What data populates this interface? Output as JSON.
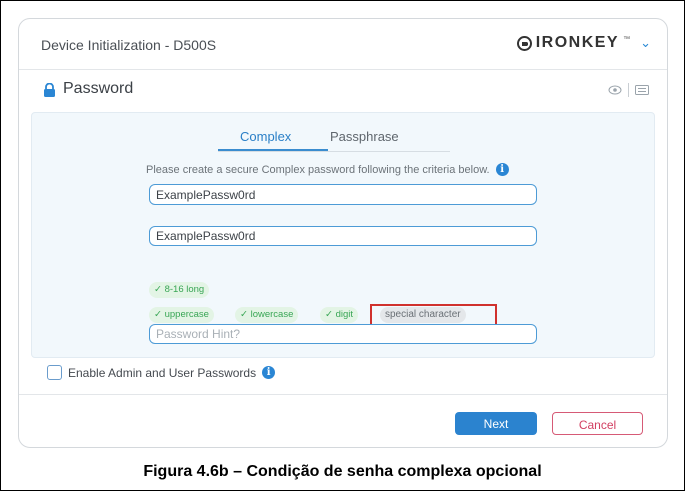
{
  "window": {
    "title": "Device Initialization - D500S",
    "brand": {
      "name": "IRONKEY",
      "trademark": "™"
    }
  },
  "section": {
    "title": "Password"
  },
  "tabs": [
    {
      "label": "Complex",
      "active": true
    },
    {
      "label": "Passphrase",
      "active": false
    }
  ],
  "form": {
    "instructions": "Please create a secure Complex password following the criteria below.",
    "password_value": "ExamplePassw0rd",
    "confirm_value": "ExamplePassw0rd",
    "hint_placeholder": "Password Hint?"
  },
  "criteria": [
    {
      "label": "✓ 8-16 long",
      "met": true
    },
    {
      "label": "✓ uppercase",
      "met": true
    },
    {
      "label": "✓ lowercase",
      "met": true
    },
    {
      "label": "✓ digit",
      "met": true
    },
    {
      "label": "special character",
      "met": false
    }
  ],
  "options": {
    "enable_admin_user": "Enable Admin and User Passwords"
  },
  "buttons": {
    "next": "Next",
    "cancel": "Cancel"
  },
  "caption": "Figura 4.6b – Condição de senha complexa opcional",
  "colors": {
    "accent": "#2b83cf",
    "success": "#39a655",
    "cancel": "#d24062",
    "highlight": "#d0312d"
  }
}
